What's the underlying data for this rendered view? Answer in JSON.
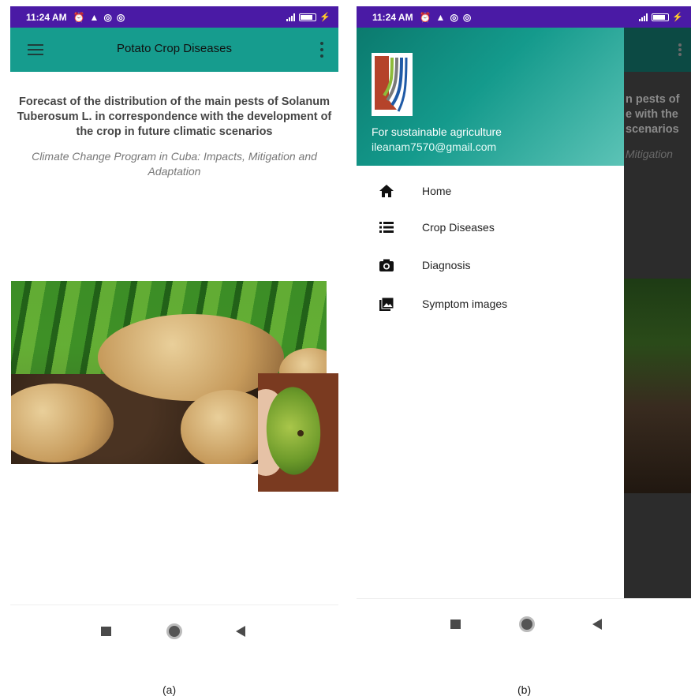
{
  "status_bar": {
    "time": "11:24 AM"
  },
  "panel_a": {
    "app_title": "Potato Crop Diseases",
    "heading": "Forecast of the distribution of the main pests of Solanum Tuberosum L. in correspondence with the development of the crop in future climatic scenarios",
    "subheading": "Climate Change Program in Cuba: Impacts, Mitigation and Adaptation",
    "caption": "(a)"
  },
  "panel_b": {
    "drawer_header": {
      "tagline": "For sustainable agriculture",
      "email": "ileanam7570@gmail.com"
    },
    "menu_items": [
      {
        "label": "Home",
        "icon": "home-icon"
      },
      {
        "label": "Crop Diseases",
        "icon": "list-icon"
      },
      {
        "label": "Diagnosis",
        "icon": "camera-icon"
      },
      {
        "label": "Symptom images",
        "icon": "images-icon"
      }
    ],
    "behind_drawer_text": {
      "line1": "n pests of",
      "line2": "e with the",
      "line3": "scenarios",
      "line4": "Mitigation"
    },
    "caption": "(b)"
  },
  "colors": {
    "status_bar": "#4a1aa5",
    "app_bar": "#169c8e",
    "drawer_header_start": "#0b7a6e",
    "drawer_header_end": "#5cc3b6"
  }
}
